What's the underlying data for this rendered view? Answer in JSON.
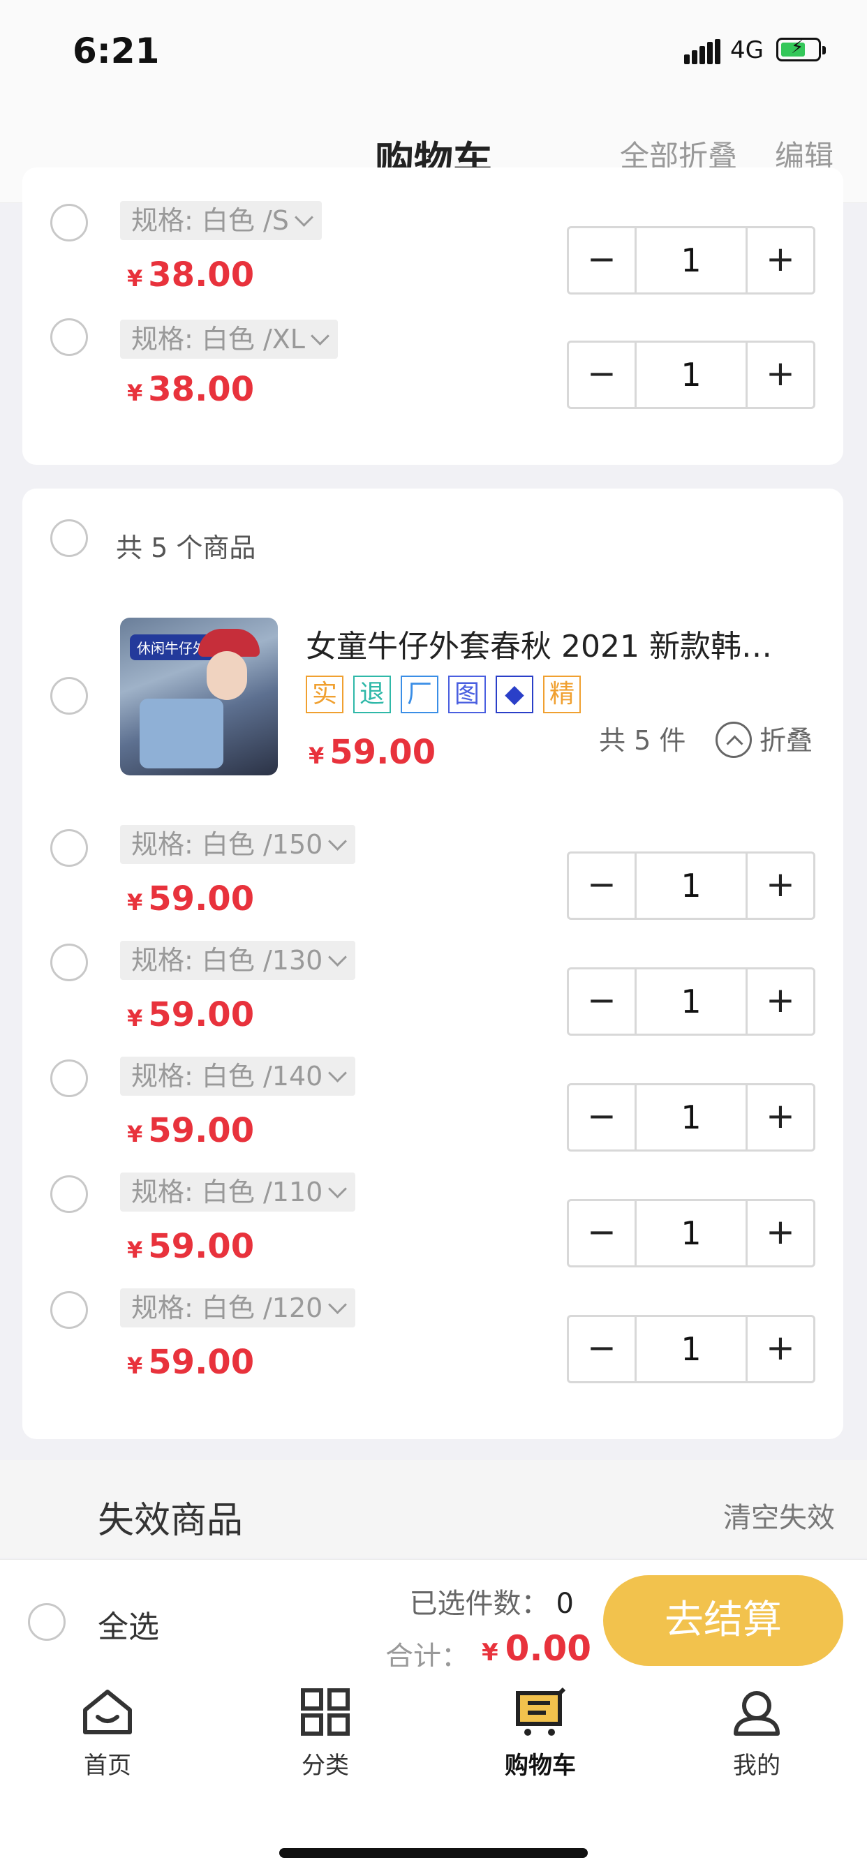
{
  "status_bar": {
    "time": "6:21",
    "network": "4G"
  },
  "header": {
    "title": "购物车",
    "collapse_all": "全部折叠",
    "edit": "编辑"
  },
  "group1": {
    "items": [
      {
        "spec": "规格: 白色 /S",
        "price": "38.00",
        "qty": "1"
      },
      {
        "spec": "规格: 白色 /XL",
        "price": "38.00",
        "qty": "1"
      }
    ]
  },
  "group2": {
    "count_label": "共 5 个商品",
    "product": {
      "name": "女童牛仔外套春秋 2021 新款韩…",
      "thumb_tag": "休闲牛仔外套",
      "price": "59.00",
      "total_pieces": "共 5 件",
      "fold": "折叠",
      "badges": [
        {
          "label": "实",
          "color": "#f0a030"
        },
        {
          "label": "退",
          "color": "#2fb8a8"
        },
        {
          "label": "厂",
          "color": "#3a8ee6"
        },
        {
          "label": "图",
          "color": "#4a5fe0"
        },
        {
          "label": "◆",
          "color": "#2a3fc8"
        },
        {
          "label": "精",
          "color": "#f0a030"
        }
      ]
    },
    "items": [
      {
        "spec": "规格: 白色 /150",
        "price": "59.00",
        "qty": "1"
      },
      {
        "spec": "规格: 白色 /130",
        "price": "59.00",
        "qty": "1"
      },
      {
        "spec": "规格: 白色 /140",
        "price": "59.00",
        "qty": "1"
      },
      {
        "spec": "规格: 白色 /110",
        "price": "59.00",
        "qty": "1"
      },
      {
        "spec": "规格: 白色 /120",
        "price": "59.00",
        "qty": "1"
      }
    ]
  },
  "currency": "¥",
  "invalid": {
    "title": "失效商品",
    "clear": "清空失效"
  },
  "checkout": {
    "select_all": "全选",
    "selected_label": "已选件数：",
    "selected_count": "0",
    "total_label": "合计：",
    "total_value": "0.00",
    "button": "去结算"
  },
  "tabs": [
    {
      "label": "首页",
      "icon": "home-icon"
    },
    {
      "label": "分类",
      "icon": "grid-icon"
    },
    {
      "label": "购物车",
      "icon": "cart-icon"
    },
    {
      "label": "我的",
      "icon": "user-icon"
    }
  ],
  "colors": {
    "price": "#e8323c",
    "checkout_button": "#f2c24d"
  }
}
